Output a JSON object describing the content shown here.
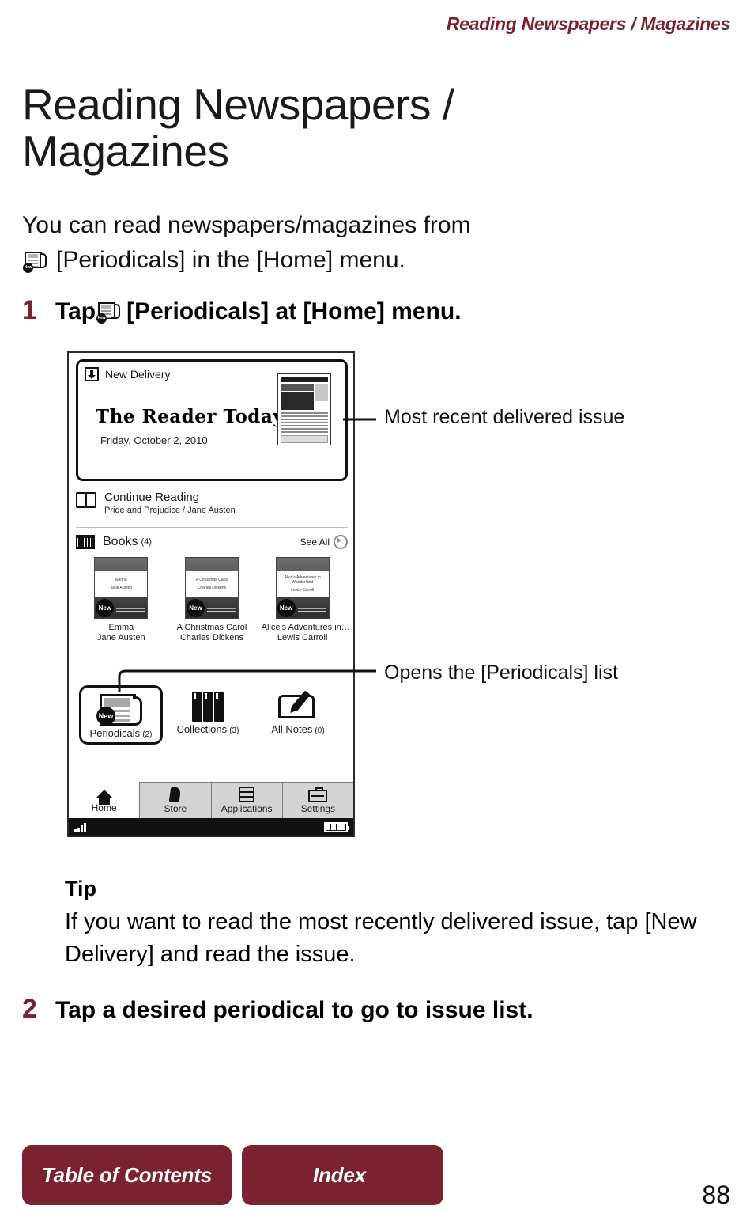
{
  "running_head": "Reading Newspapers / Magazines",
  "page_title": "Reading Newspapers / Magazines",
  "intro": {
    "line1": "You can read newspapers/magazines from",
    "line2_before": "",
    "line2_after": "[Periodicals] in the [Home] menu."
  },
  "steps": [
    {
      "number": "1",
      "text_before": "Tap",
      "text_after": "[Periodicals] at [Home] menu."
    },
    {
      "number": "2",
      "text": "Tap a desired periodical to go to issue list."
    }
  ],
  "device": {
    "new_delivery": {
      "label": "New Delivery",
      "masthead": "The Reader Today",
      "date": "Friday, October 2, 2010"
    },
    "continue_reading": {
      "title": "Continue Reading",
      "subtitle": "Pride and Prejudice / Jane Austen"
    },
    "books_section": {
      "label": "Books",
      "count": "(4)",
      "see_all": "See All",
      "items": [
        {
          "title": "Emma",
          "author": "Jane Austen",
          "cover_title": "Emma",
          "cover_author": "Jane Austen",
          "badge": "New"
        },
        {
          "title": "A Christmas Carol",
          "author": "Charles Dickens",
          "cover_title": "A Christmas Carol",
          "cover_author": "Charles Dickens",
          "badge": "New"
        },
        {
          "title": "Alice's Adventures in…",
          "author": "Lewis Carroll",
          "cover_title": "Alice's Adventures in Wonderland",
          "cover_author": "Lewis Carroll",
          "badge": "New"
        }
      ]
    },
    "categories": [
      {
        "label": "Periodicals",
        "count": "(2)",
        "badge": "New",
        "selected": true
      },
      {
        "label": "Collections",
        "count": "(3)",
        "selected": false
      },
      {
        "label": "All Notes",
        "count": "(0)",
        "selected": false
      }
    ],
    "tabs": [
      {
        "label": "Home",
        "active": true
      },
      {
        "label": "Store",
        "active": false
      },
      {
        "label": "Applications",
        "active": false
      },
      {
        "label": "Settings",
        "active": false
      }
    ]
  },
  "callouts": [
    "Most recent delivered issue",
    "Opens the [Periodicals] list"
  ],
  "tip": {
    "heading": "Tip",
    "body": "If you want to read the most recently delivered issue, tap [New Delivery] and read the issue."
  },
  "footer": {
    "toc": "Table of Contents",
    "index": "Index",
    "page_number": "88"
  },
  "colors": {
    "accent": "#7B2230",
    "text": "#111111"
  }
}
